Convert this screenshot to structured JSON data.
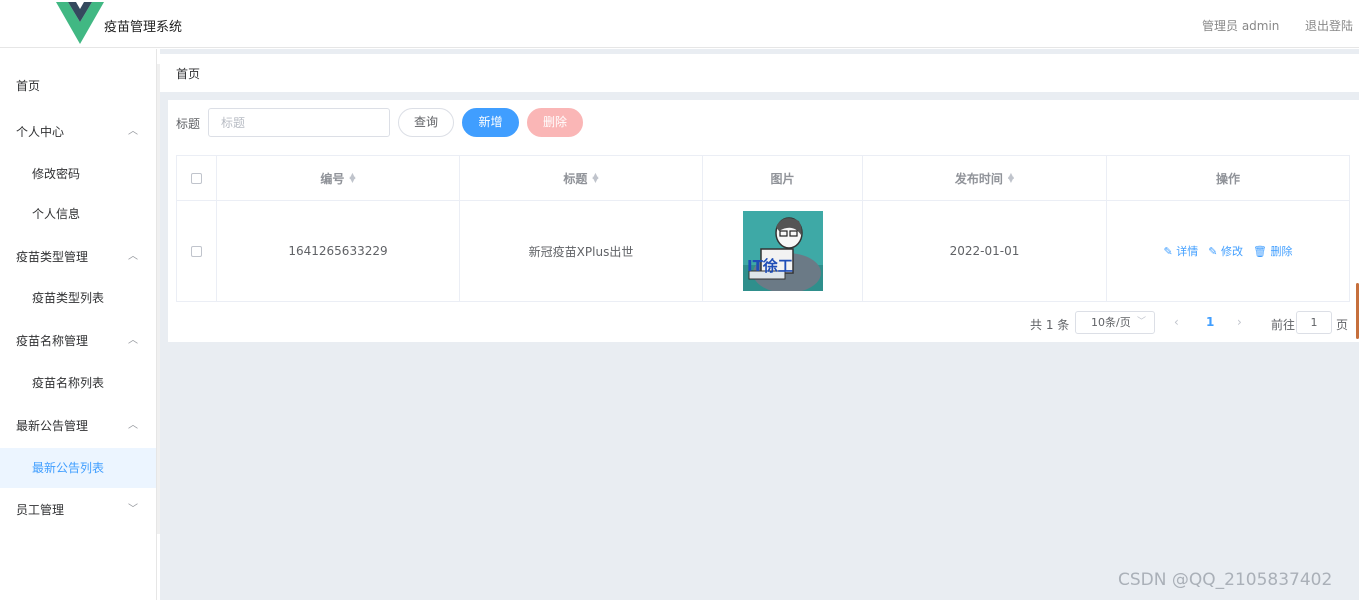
{
  "header": {
    "title": "疫苗管理系统",
    "admin_label": "管理员 admin",
    "logout_label": "退出登陆",
    "logo_colors": {
      "outer": "#41b883",
      "inner": "#35495e"
    }
  },
  "sidebar": {
    "items": [
      {
        "label": "首页",
        "level": "top",
        "expand": ""
      },
      {
        "label": "个人中心",
        "level": "top",
        "expand": "up"
      },
      {
        "label": "修改密码",
        "level": "sub"
      },
      {
        "label": "个人信息",
        "level": "sub"
      },
      {
        "label": "疫苗类型管理",
        "level": "top",
        "expand": "up"
      },
      {
        "label": "疫苗类型列表",
        "level": "sub"
      },
      {
        "label": "疫苗名称管理",
        "level": "top",
        "expand": "up"
      },
      {
        "label": "疫苗名称列表",
        "level": "sub"
      },
      {
        "label": "最新公告管理",
        "level": "top",
        "expand": "up"
      },
      {
        "label": "最新公告列表",
        "level": "sub",
        "active": true
      },
      {
        "label": "员工管理",
        "level": "top",
        "expand": "down"
      }
    ]
  },
  "breadcrumb": "首页",
  "search": {
    "label": "标题",
    "placeholder": "标题",
    "value": "",
    "query_label": "查询",
    "add_label": "新增",
    "delete_label": "删除"
  },
  "table": {
    "columns": [
      "编号",
      "标题",
      "图片",
      "发布时间",
      "操作"
    ],
    "rows": [
      {
        "id": "1641265633229",
        "title": "新冠疫苗XPlus出世",
        "image_text": "IT徐工",
        "date": "2022-01-01",
        "ops": [
          "详情",
          "修改",
          "删除"
        ]
      }
    ]
  },
  "pagination": {
    "total": "共 1 条",
    "page_size": "10条/页",
    "current_page": "1",
    "goto_label": "前往",
    "goto_value": "1",
    "page_unit": "页"
  },
  "watermark": "CSDN @QQ_2105837402",
  "colors": {
    "primary": "#409eff",
    "danger_light": "#fab6b6",
    "main_bg": "#e9edf2",
    "active_bg": "#ecf5ff"
  }
}
